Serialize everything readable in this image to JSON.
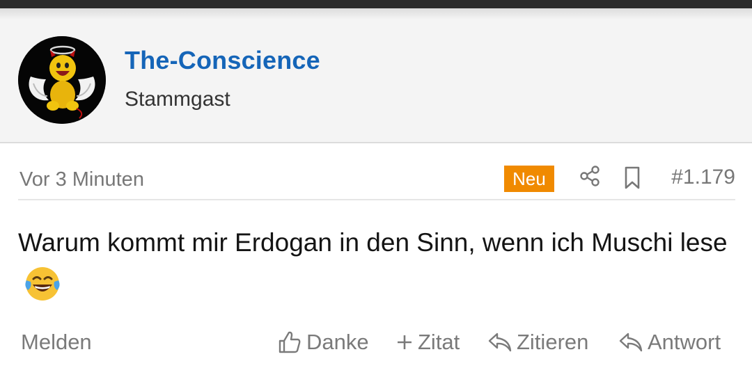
{
  "post": {
    "username": "The-Conscience",
    "user_title": "Stammgast",
    "time": "Vor 3 Minuten",
    "badge": "Neu",
    "post_number": "#1.179",
    "body_text": "Warum kommt mir Erdogan in den Sinn, wenn ich Muschi lese",
    "emoji_icon": "face-with-tears-of-joy-icon"
  },
  "actions": {
    "report": "Melden",
    "thanks": "Danke",
    "quote_add": "Zitat",
    "cite": "Zitieren",
    "reply": "Antwort"
  },
  "colors": {
    "username": "#1565b8",
    "badge": "#f08a00",
    "muted": "#777777",
    "header_bg": "#f4f4f4"
  }
}
